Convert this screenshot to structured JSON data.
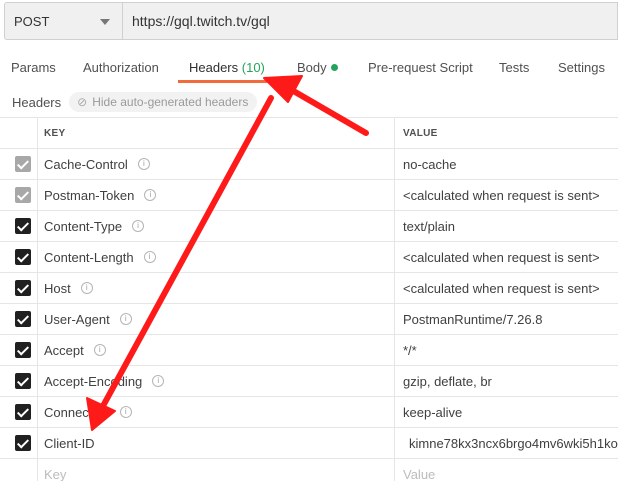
{
  "request": {
    "method": "POST",
    "url": "https://gql.twitch.tv/gql"
  },
  "tabs": [
    {
      "label": "Params"
    },
    {
      "label": "Authorization"
    },
    {
      "label": "Headers",
      "count": "(10)"
    },
    {
      "label": "Body"
    },
    {
      "label": "Pre-request Script"
    },
    {
      "label": "Tests"
    },
    {
      "label": "Settings"
    }
  ],
  "headers_section": {
    "title": "Headers",
    "hide_button": "Hide auto-generated headers",
    "columns": {
      "key": "KEY",
      "value": "VALUE"
    },
    "rows": [
      {
        "key": "Cache-Control",
        "value": "no-cache"
      },
      {
        "key": "Postman-Token",
        "value": "<calculated when request is sent>"
      },
      {
        "key": "Content-Type",
        "value": "text/plain"
      },
      {
        "key": "Content-Length",
        "value": "<calculated when request is sent>"
      },
      {
        "key": "Host",
        "value": "<calculated when request is sent>"
      },
      {
        "key": "User-Agent",
        "value": "PostmanRuntime/7.26.8"
      },
      {
        "key": "Accept",
        "value": "*/*"
      },
      {
        "key": "Accept-Encoding",
        "value": "gzip, deflate, br"
      },
      {
        "key": "Connection",
        "value": "keep-alive"
      },
      {
        "key": "Client-ID",
        "value": "kimne78kx3ncx6brgo4mv6wki5h1ko"
      }
    ],
    "new_row": {
      "key_placeholder": "Key",
      "value_placeholder": "Value"
    }
  },
  "colors": {
    "accent": "#f26b3a",
    "count_green": "#26a35b",
    "annotation_arrow": "#ff1a1a"
  }
}
